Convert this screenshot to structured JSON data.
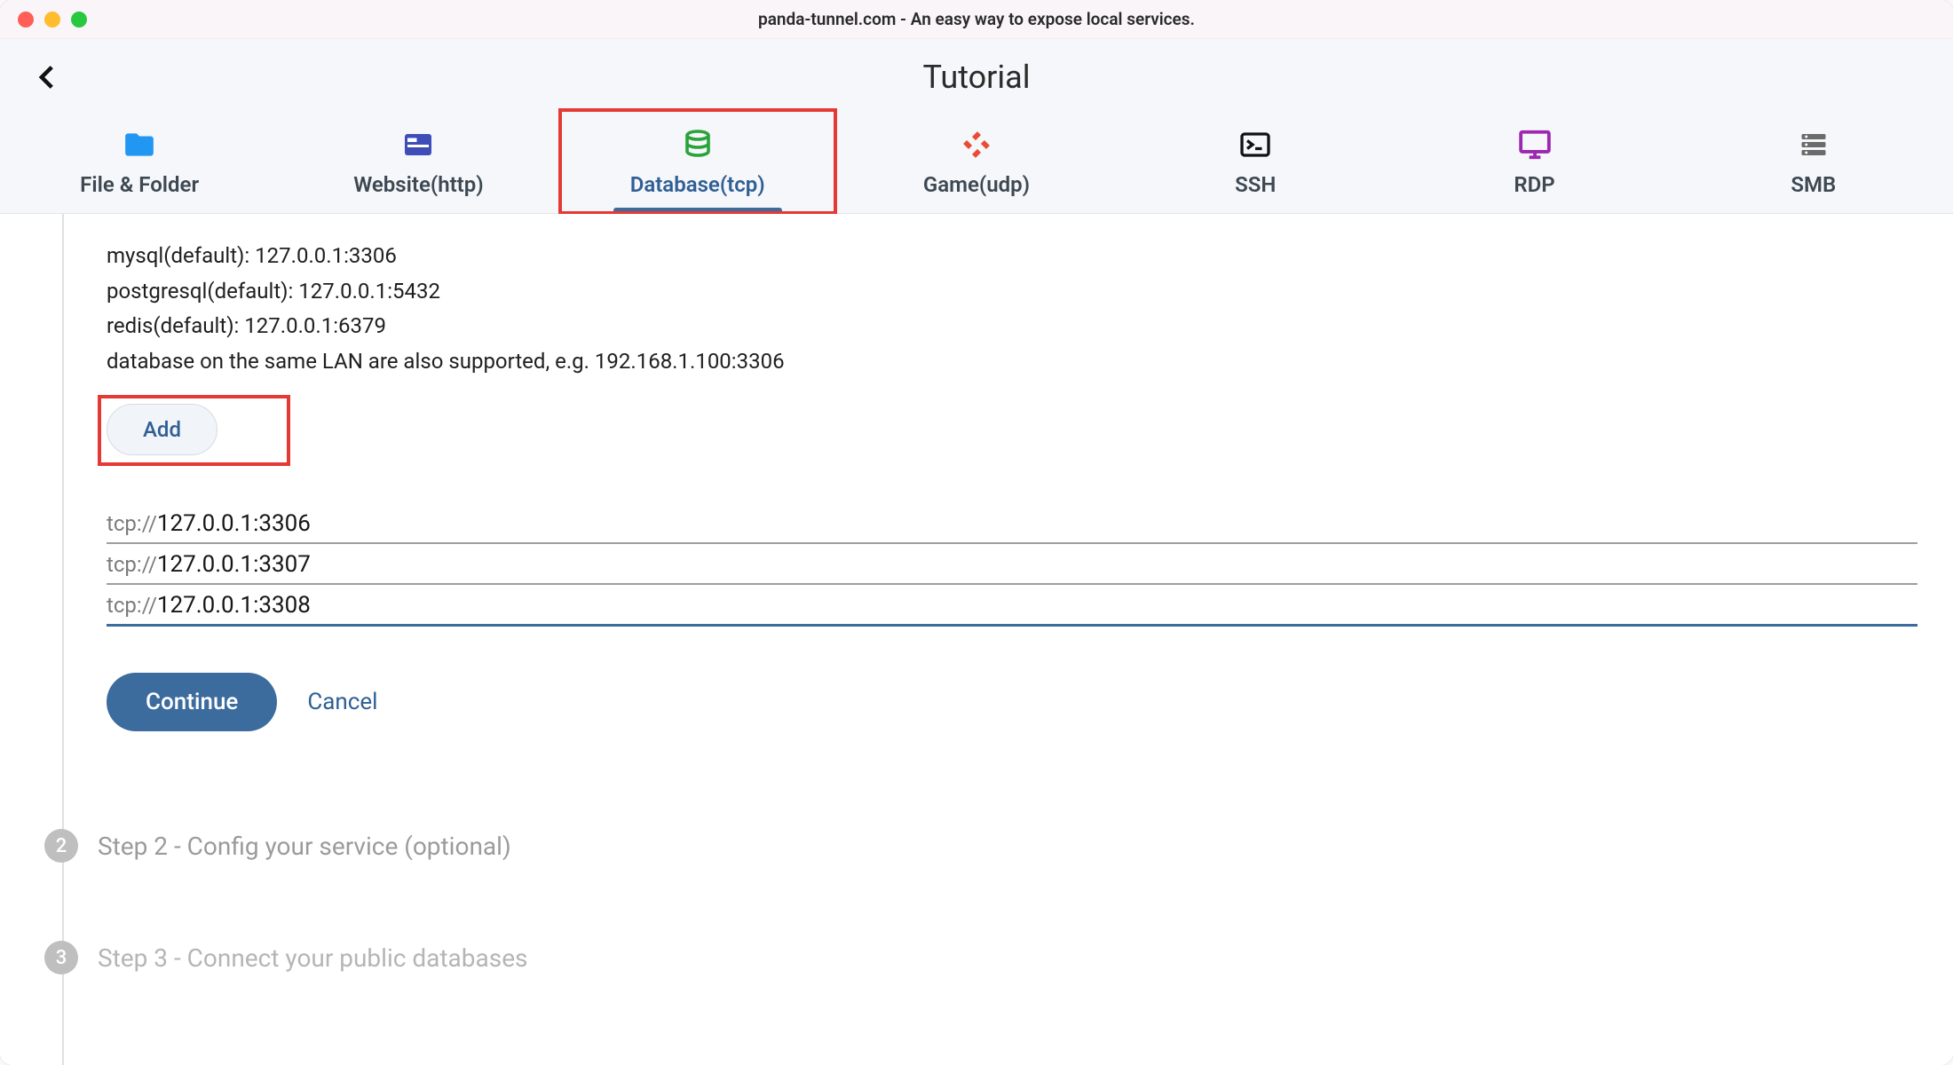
{
  "window": {
    "title": "panda-tunnel.com - An easy way to expose local services."
  },
  "header": {
    "page_title": "Tutorial"
  },
  "tabs": [
    {
      "label": "File & Folder"
    },
    {
      "label": "Website(http)"
    },
    {
      "label": "Database(tcp)"
    },
    {
      "label": "Game(udp)"
    },
    {
      "label": "SSH"
    },
    {
      "label": "RDP"
    },
    {
      "label": "SMB"
    }
  ],
  "info_lines": [
    "mysql(default): 127.0.0.1:3306",
    "postgresql(default): 127.0.0.1:5432",
    "redis(default): 127.0.0.1:6379",
    "database on the same LAN are also supported, e.g. 192.168.1.100:3306"
  ],
  "add_button_label": "Add",
  "inputs": [
    {
      "prefix": "tcp://",
      "value": "127.0.0.1:3306",
      "active": false
    },
    {
      "prefix": "tcp://",
      "value": "127.0.0.1:3307",
      "active": false
    },
    {
      "prefix": "tcp://",
      "value": "127.0.0.1:3308",
      "active": true
    }
  ],
  "actions": {
    "continue": "Continue",
    "cancel": "Cancel"
  },
  "steps": [
    {
      "num": "2",
      "label": "Step 2 - Config your service (optional)"
    },
    {
      "num": "3",
      "label": "Step 3 - Connect your public databases"
    }
  ]
}
